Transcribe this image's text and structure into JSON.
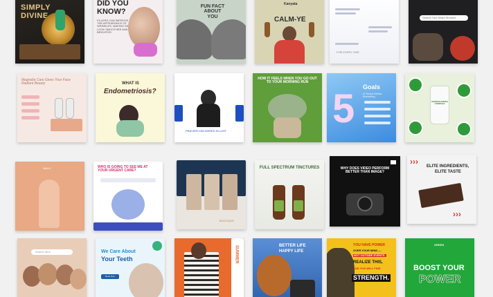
{
  "grid": {
    "row1": {
      "t1": {
        "title_a": "SIMPLY",
        "title_b": "DIVINE"
      },
      "t2": {
        "title": "DID YOU KNOW?",
        "body": "FILLERS CAN IMPROVE THE APPEARANCE OF WRINKLES, MAKING SKIN LOOK SMOOTHER AND BRIGHTER."
      },
      "t3": {
        "title": "FUN FACT ABOUT YOU"
      },
      "t4": {
        "brand": "Kanyata",
        "title": "CALM-YE"
      },
      "t5": {
        "badge": "FOR EVERY ONE"
      },
      "t6": {
        "search": "Search Your Major Moment"
      }
    },
    "row2": {
      "t1": {
        "title": "Magnolia Care Gives Your Face Radiant Beauty"
      },
      "t2": {
        "title_a": "WHAT IS",
        "title_b": "Endometriosis?"
      },
      "t3": {
        "caption": "PRAYERS DELIVERED IN LUST"
      },
      "t4": {
        "title": "HOW IT FEELS WHEN YOU GO OUT TO YOUR MORNING RUN"
      },
      "t5": {
        "number": "5",
        "title": "Goals",
        "subtitle": "of Social Media Marketing"
      },
      "t6": {
        "product": "ASHWAGANDHA COMPLEX"
      }
    },
    "row3": {
      "t1": {
        "brand": "NAILS"
      },
      "t2": {
        "title": "WHO IS GOING TO SEE ME AT YOUR URGENT CARE?"
      },
      "t3": {
        "brand": "BOUTIQUE"
      },
      "t4": {
        "title": "FULL SPECTRUM TINCTURES"
      },
      "t5": {
        "title": "WHY DOES VIDEO PERFORM BETTER THAN IMAGE?"
      },
      "t6": {
        "title_a": "ELITE INGREDIENTS,",
        "title_b": "ELITE TASTE"
      }
    },
    "row4": {
      "t1": {
        "search": "Search here"
      },
      "t2": {
        "title_a": "We Care About",
        "title_b": "Your Teeth",
        "cta": "Book Now"
      },
      "t3": {
        "label": "SUMMER"
      },
      "t4": {
        "title_a": "BETTER LIFE",
        "title_b": "HAPPY LIFE"
      },
      "t5": {
        "line1": "YOU HAVE POWER",
        "line2": "OVER YOUR MIND —",
        "line3": "NOT OUTSIDE EVENTS.",
        "line4": "REALIZE THIS,",
        "line5": "AND YOU WILL FIND",
        "line6": "STRENGTH."
      },
      "t6": {
        "brand": "GREEN",
        "title_a": "BOOST YOUR",
        "title_b": "POWER"
      }
    }
  },
  "colors": {
    "page_bg": "#f1f1f2",
    "accent_orange": "#e9a94f",
    "green": "#21a33a",
    "red": "#e6402b",
    "yellow": "#f4c11c"
  }
}
